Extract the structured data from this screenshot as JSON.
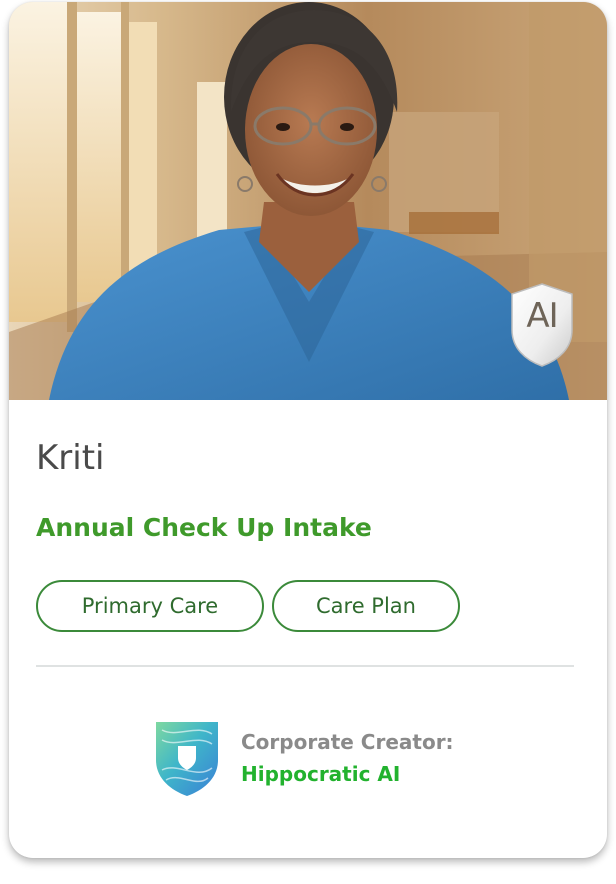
{
  "card": {
    "name": "Kriti",
    "subtitle": "Annual Check Up Intake",
    "tags": [
      "Primary Care",
      "Care Plan"
    ],
    "badge_label": "AI",
    "photo_alt": "portrait-photo"
  },
  "creator": {
    "caption": "Corporate Creator:",
    "name": "Hippocratic AI",
    "logo_icon": "hippocratic-shield-icon"
  },
  "colors": {
    "subtitle_green": "#3f9a2b",
    "tag_border": "#3b8a3a",
    "creator_green": "#22b22e",
    "scrub_blue": "#3f86c4"
  }
}
